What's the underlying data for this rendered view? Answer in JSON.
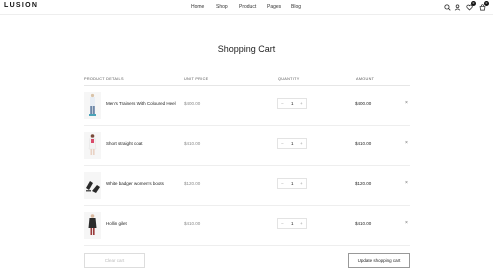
{
  "header": {
    "logo": "LUSION",
    "nav": [
      "Home",
      "Shop",
      "Product",
      "Pages",
      "Blog"
    ],
    "wishlist_count": "0",
    "cart_count": "0",
    "icons": [
      "search-icon",
      "user-icon",
      "heart-icon",
      "cart-icon"
    ]
  },
  "cart": {
    "title": "Shopping Cart",
    "columns": {
      "product": "PRODUCT DETAILS",
      "unit_price": "UNIT PRICE",
      "quantity": "QUANTITY",
      "amount": "AMOUNT"
    },
    "items": [
      {
        "name": "Men's Trainers With Coloured Heel",
        "unit_price": "$400.00",
        "qty": "1",
        "amount": "$400.00"
      },
      {
        "name": "Short straight coat",
        "unit_price": "$410.00",
        "qty": "1",
        "amount": "$410.00"
      },
      {
        "name": "White badger women's boots",
        "unit_price": "$120.00",
        "qty": "1",
        "amount": "$120.00"
      },
      {
        "name": "Hollin gilet",
        "unit_price": "$410.00",
        "qty": "1",
        "amount": "$410.00"
      }
    ],
    "minus": "−",
    "plus": "+",
    "remove": "×",
    "clear_label": "Clear cart",
    "update_label": "Update shopping cart"
  }
}
